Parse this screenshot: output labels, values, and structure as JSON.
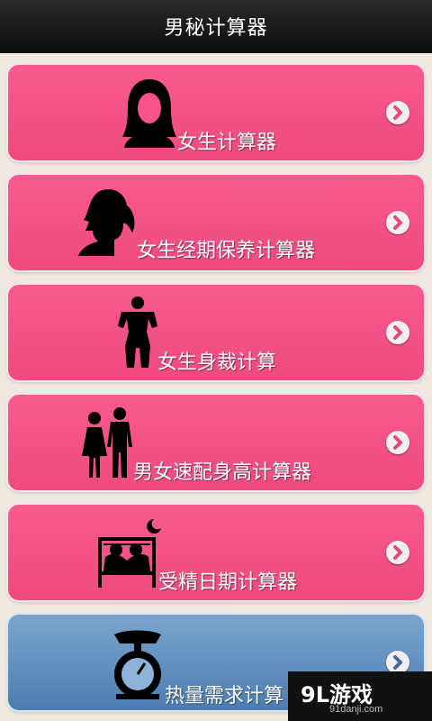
{
  "header": {
    "title": "男秘计算器"
  },
  "menu": [
    {
      "label": "女生计算器",
      "icon": "woman-face-icon"
    },
    {
      "label": "女生经期保养计算器",
      "icon": "woman-profile-icon"
    },
    {
      "label": "女生身裁计算",
      "icon": "body-shape-icon"
    },
    {
      "label": "男女速配身高计算器",
      "icon": "couple-icon"
    },
    {
      "label": "受精日期计算器",
      "icon": "couple-in-bed-icon"
    },
    {
      "label": "热量需求计算",
      "icon": "scale-icon"
    }
  ],
  "watermark": {
    "brand": "9L游戏",
    "site": "91danji.com"
  },
  "colors": {
    "pink": "#f75289",
    "blue": "#5f8fc2",
    "titlebar": "#141414"
  }
}
